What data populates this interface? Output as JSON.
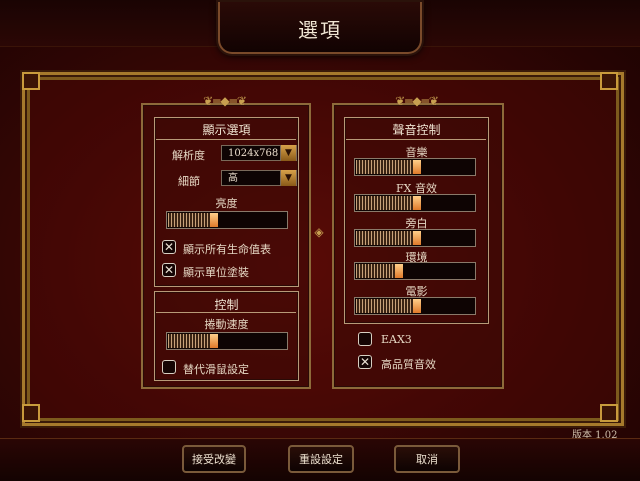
{
  "window": {
    "title": "選項"
  },
  "display": {
    "title": "顯示選項",
    "resolution_label": "解析度",
    "resolution_value": "1024x768",
    "detail_label": "細節",
    "detail_value": "高",
    "brightness_label": "亮度",
    "brightness_level": 0.42,
    "show_health_label": "顯示所有生命值表",
    "show_health_checked": true,
    "show_decals_label": "顯示單位塗裝",
    "show_decals_checked": true
  },
  "control": {
    "title": "控制",
    "scroll_speed_label": "捲動速度",
    "scroll_speed_level": 0.42,
    "alt_mouse_label": "替代滑鼠設定",
    "alt_mouse_checked": false
  },
  "sound": {
    "title": "聲音控制",
    "sliders": [
      {
        "label": "音樂",
        "level": 0.55
      },
      {
        "label": "FX 音效",
        "level": 0.55
      },
      {
        "label": "旁白",
        "level": 0.55
      },
      {
        "label": "環境",
        "level": 0.4
      },
      {
        "label": "電影",
        "level": 0.55
      }
    ],
    "eax_label": "EAX3",
    "eax_checked": false,
    "hq_label": "高品質音效",
    "hq_checked": true
  },
  "footer": {
    "version": "版本 1.02",
    "accept_label": "接受改變",
    "reset_label": "重設設定",
    "cancel_label": "取消"
  },
  "colors": {
    "accent": "#a67a2c",
    "background": "#3a0705",
    "text": "#e9dccb"
  }
}
